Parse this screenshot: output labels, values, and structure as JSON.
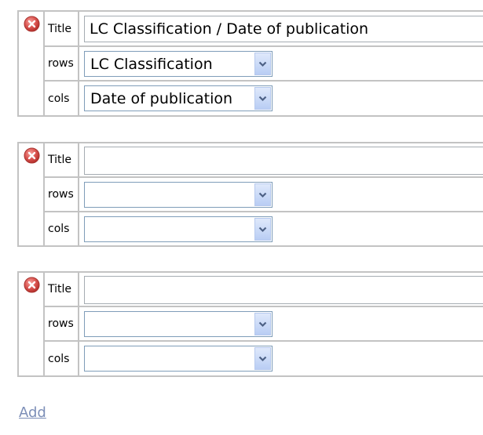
{
  "tables": [
    {
      "title_label": "Title",
      "title_value": "LC Classification / Date of publication",
      "rows_label": "rows",
      "rows_value": "LC Classification",
      "cols_label": "cols",
      "cols_value": "Date of publication"
    },
    {
      "title_label": "Title",
      "title_value": "",
      "rows_label": "rows",
      "rows_value": "",
      "cols_label": "cols",
      "cols_value": ""
    },
    {
      "title_label": "Title",
      "title_value": "",
      "rows_label": "rows",
      "rows_value": "",
      "cols_label": "cols",
      "cols_value": ""
    }
  ],
  "add_label": "Add",
  "icons": {
    "remove": "remove-icon",
    "dropdown": "chevron-down-icon"
  },
  "colors": {
    "border": "#c3c3c3",
    "remove_icon": "#d9534f",
    "link": "#7d8fb8",
    "dropdown_button": "#c6d6f6"
  }
}
